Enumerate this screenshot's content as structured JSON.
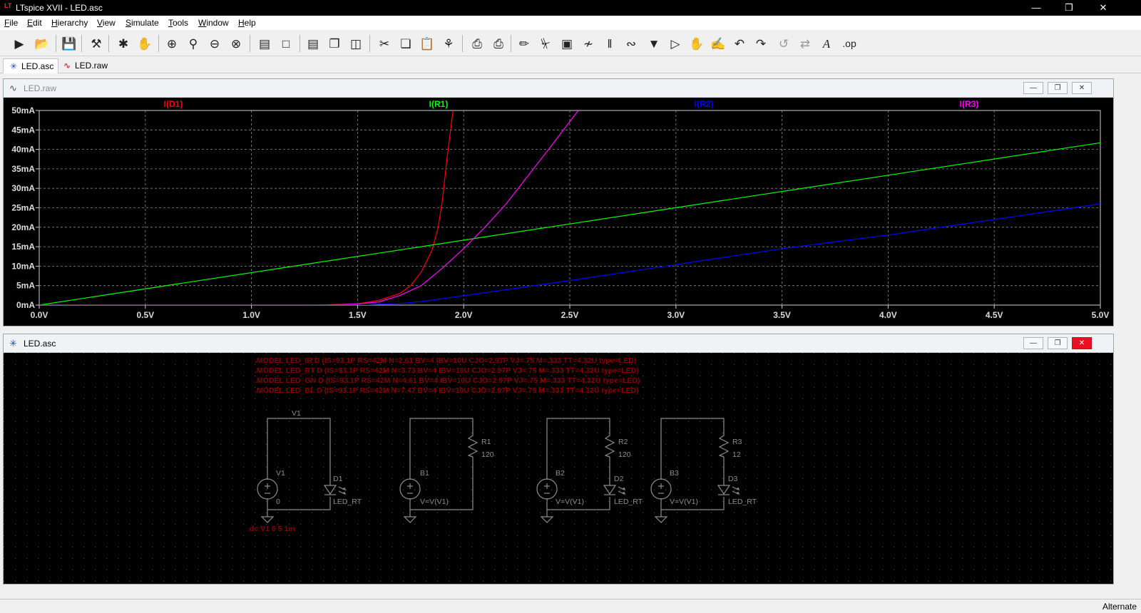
{
  "window": {
    "title": "LTspice XVII - LED.asc"
  },
  "menu": [
    {
      "label": "File",
      "u": "F",
      "rest": "ile"
    },
    {
      "label": "Edit",
      "u": "E",
      "rest": "dit"
    },
    {
      "label": "Hierarchy",
      "u": "H",
      "rest": "ierarchy"
    },
    {
      "label": "View",
      "u": "V",
      "rest": "iew"
    },
    {
      "label": "Simulate",
      "u": "S",
      "rest": "imulate"
    },
    {
      "label": "Tools",
      "u": "T",
      "rest": "ools"
    },
    {
      "label": "Window",
      "u": "W",
      "rest": "indow"
    },
    {
      "label": "Help",
      "u": "H",
      "rest": "elp"
    }
  ],
  "toolbar_icons": [
    "run-icon",
    "open-icon",
    "save-icon",
    "control-panel-icon",
    "halt-icon",
    "pan-icon",
    "zoom-in-icon",
    "zoom-area-icon",
    "zoom-out-icon",
    "zoom-fit-icon",
    "plot-settings-icon",
    "autorange-icon",
    "tile-horizontal-icon",
    "cascade-icon",
    "tile-vertical-icon",
    "cut-icon",
    "copy-icon",
    "paste-icon",
    "find-icon",
    "print-icon",
    "print-setup-icon",
    "draw-wire-icon",
    "ground-icon",
    "label-net-icon",
    "resistor-icon",
    "capacitor-icon",
    "inductor-icon",
    "diode-icon",
    "component-icon",
    "move-icon",
    "drag-icon",
    "undo-icon",
    "redo-icon",
    "rotate-icon",
    "mirror-icon",
    "text-icon",
    "spice-directive-icon"
  ],
  "tabs": [
    {
      "label": "LED.asc",
      "active": true
    },
    {
      "label": "LED.raw",
      "active": false
    }
  ],
  "plot_window": {
    "title": "LED.raw"
  },
  "schematic_window": {
    "title": "LED.asc"
  },
  "status": {
    "text": "Alternate"
  },
  "colors": {
    "d1": "#ff0000",
    "r1": "#00ff00",
    "r2": "#0000ff",
    "r3": "#ff00ff",
    "directive": "#8b0000",
    "wire": "#8c8c8c"
  },
  "chart_data": {
    "type": "line",
    "xlim": [
      0,
      5
    ],
    "ylim": [
      0,
      50
    ],
    "x_ticks": [
      "0.0V",
      "0.5V",
      "1.0V",
      "1.5V",
      "2.0V",
      "2.5V",
      "3.0V",
      "3.5V",
      "4.0V",
      "4.5V",
      "5.0V"
    ],
    "y_ticks": [
      "0mA",
      "5mA",
      "10mA",
      "15mA",
      "20mA",
      "25mA",
      "30mA",
      "35mA",
      "40mA",
      "45mA",
      "50mA"
    ],
    "grid": true,
    "series": [
      {
        "name": "I(D1)",
        "color": "#ff0000",
        "x": [
          0,
          1.3,
          1.5,
          1.6,
          1.7,
          1.75,
          1.8,
          1.85,
          1.88,
          1.9,
          1.92,
          1.95
        ],
        "y": [
          0,
          0,
          0.3,
          1.2,
          3,
          5,
          8.5,
          14,
          20,
          27,
          37,
          50
        ]
      },
      {
        "name": "I(R1)",
        "color": "#00ff00",
        "x": [
          0,
          5
        ],
        "y": [
          0,
          41.7
        ]
      },
      {
        "name": "I(R2)",
        "color": "#0000ff",
        "x": [
          0,
          1.5,
          1.7,
          1.8,
          2.0,
          2.5,
          3.0,
          3.5,
          4.0,
          4.5,
          5.0
        ],
        "y": [
          0,
          0,
          0.4,
          0.9,
          2.4,
          6.3,
          10.4,
          14.5,
          18.0,
          22.0,
          26.0
        ]
      },
      {
        "name": "I(R3)",
        "color": "#ff00ff",
        "x": [
          0,
          1.35,
          1.5,
          1.6,
          1.7,
          1.8,
          1.9,
          2.0,
          2.1,
          2.2,
          2.3,
          2.4,
          2.54
        ],
        "y": [
          0,
          0,
          0.3,
          0.8,
          2.5,
          5,
          9.5,
          14.5,
          20,
          26,
          33,
          40,
          50
        ]
      }
    ]
  },
  "schematic": {
    "directives": [
      ".MODEL LED_IR D (IS=93.1P RS=42M N=2.61 BV=4 IBV=10U CJO=2.97P VJ=.75 M=.333 TT=4.32U type=LED)",
      ".MODEL LED_RT D (IS=93.1P RS=42M N=3.73 BV=4 IBV=10U CJO=2.97P VJ=.75 M=.333 TT=4.32U type=LED)",
      ".MODEL LED_GN D (IS=93.1P RS=42M N=4.61 BV=4 IBV=10U CJO=2.97P VJ=.75 M=.333 TT=4.32U type=LED)",
      ".MODEL LED_BL D (IS=93.1P RS=42M N=7.47 BV=4 IBV=10U CJO=2.97P VJ=.75 M=.333 TT=4.32U type=LED)"
    ],
    "dc_directive": ".dc V1 0 5 1m",
    "v1_top_label": "V1",
    "v1": {
      "name": "V1",
      "value": "0"
    },
    "d1": {
      "name": "D1",
      "model": "LED_RT"
    },
    "b1": {
      "name": "B1",
      "value": "V=V(V1)"
    },
    "r1": {
      "name": "R1",
      "value": "120"
    },
    "b2": {
      "name": "B2",
      "value": "V=V(V1)"
    },
    "r2": {
      "name": "R2",
      "value": "120"
    },
    "d2": {
      "name": "D2",
      "model": "LED_RT"
    },
    "b3": {
      "name": "B3",
      "value": "V=V(V1)"
    },
    "r3": {
      "name": "R3",
      "value": "12"
    },
    "d3": {
      "name": "D3",
      "model": "LED_RT"
    }
  }
}
